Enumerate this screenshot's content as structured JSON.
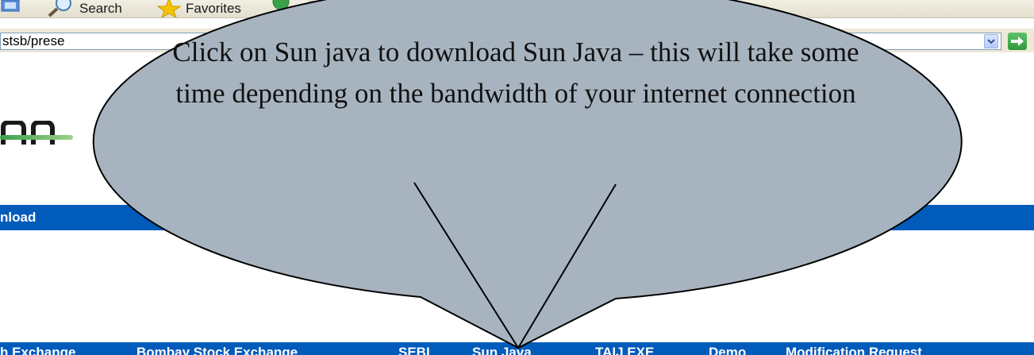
{
  "toolbar": {
    "search_label": "Search",
    "favorites_label": "Favorites",
    "icons": [
      "home-icon",
      "search-icon",
      "favorites-star-icon",
      "media-icon",
      "history-icon"
    ]
  },
  "address_bar": {
    "url_fragment": "stsb/prese",
    "icons": [
      "dropdown-arrow-icon",
      "go-arrow-icon"
    ]
  },
  "section": {
    "title_fragment": "nload"
  },
  "nav": {
    "items": [
      "h Exchange",
      "Bombay Stock Exchange",
      "SEBI",
      "Sun Java",
      "TAIJ EXE",
      "Demo",
      "Modification Request"
    ]
  },
  "callout": {
    "text": "Click on Sun java to download Sun Java – this will take some time depending on the bandwidth of  your internet connection"
  },
  "colors": {
    "nav_blue": "#005bbb",
    "callout_fill": "#a7b4c0",
    "toolbar_bg": "#ece9d8"
  }
}
